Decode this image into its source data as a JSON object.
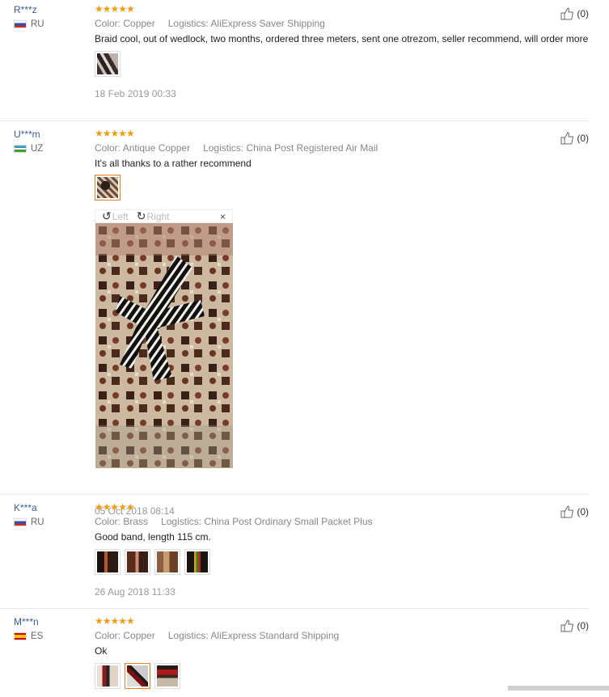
{
  "reviews": [
    {
      "user": "R***z",
      "country": "RU",
      "rating": "★★★★★",
      "color_label": "Color:",
      "color": "Copper",
      "logistics_label": "Logistics:",
      "logistics": "AliExpress Saver Shipping",
      "text": "Braid cool, out of wedlock, two months, ordered three meters, sent one otrezom, seller recommend, will order more",
      "photo_count": 1,
      "date": "18 Feb 2019 00:33",
      "likes": "(0)"
    },
    {
      "user": "U***m",
      "country": "UZ",
      "rating": "★★★★★",
      "color_label": "Color:",
      "color": "Antique Copper",
      "logistics_label": "Logistics:",
      "logistics": "China Post Registered Air Mail",
      "text": "It's all thanks to a rather recommend",
      "photo_count": 1,
      "date": "05 Oct 2018 08:14",
      "likes": "(0)"
    },
    {
      "user": "K***a",
      "country": "RU",
      "rating": "★★★★★",
      "color_label": "Color:",
      "color": "Brass",
      "logistics_label": "Logistics:",
      "logistics": "China Post Ordinary Small Packet Plus",
      "text": "Good band, length 115 cm.",
      "photo_count": 4,
      "date": "26 Aug 2018 11:33",
      "likes": "(0)"
    },
    {
      "user": "M***n",
      "country": "ES",
      "rating": "★★★★★",
      "color_label": "Color:",
      "color": "Copper",
      "logistics_label": "Logistics:",
      "logistics": "AliExpress Standard Shipping",
      "text": "Ok",
      "photo_count": 3,
      "date": "",
      "likes": "(0)"
    }
  ],
  "viewer": {
    "left_label": "Left",
    "right_label": "Right",
    "close": "×"
  },
  "colors": {
    "username": "#3b5b96",
    "stars": "#f39c12",
    "active_thumb": "#e67e22"
  }
}
